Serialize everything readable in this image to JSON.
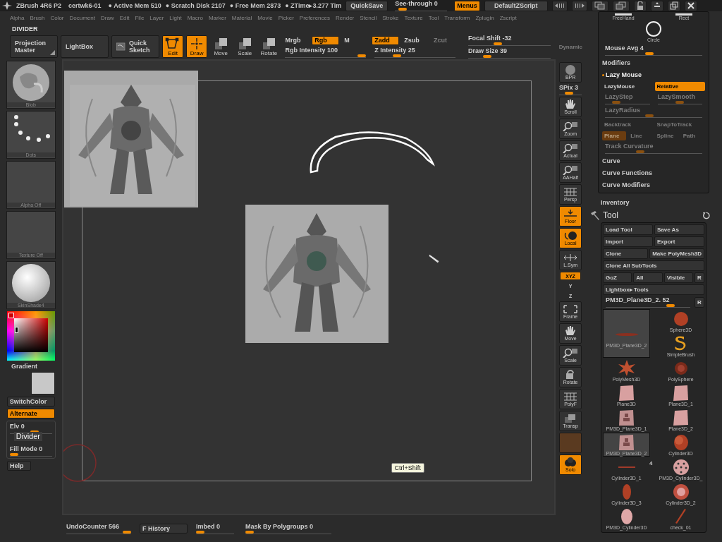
{
  "title_bar": {
    "app": "ZBrush 4R6 P2",
    "document": "certwk6-01",
    "stats": [
      "● Active Mem 510",
      "● Scratch Disk 2107",
      "● Free Mem 2873",
      "● ZTime▸3.277 Tim"
    ],
    "quicksave": "QuickSave",
    "see_through": {
      "label": "See-through  0",
      "level": 0.08
    },
    "menus": {
      "label": "Menus",
      "on": true
    },
    "zscript": "DefaultZScript"
  },
  "menu_bar": [
    "Alpha",
    "Brush",
    "Color",
    "Document",
    "Draw",
    "Edit",
    "File",
    "Layer",
    "Light",
    "Macro",
    "Marker",
    "Material",
    "Movie",
    "Picker",
    "Preferences",
    "Render",
    "Stencil",
    "Stroke",
    "Texture",
    "Tool",
    "Transform",
    "Zplugin",
    "Zscript"
  ],
  "palette_title": "DIVIDER",
  "toolbar": {
    "big_buttons": [
      {
        "label": "Projection Master",
        "kind": "corner"
      },
      {
        "label": "LightBox",
        "kind": "plain"
      },
      {
        "label": "Quick Sketch",
        "kind": "sketch"
      }
    ],
    "modes": [
      {
        "label": "Edit",
        "on": true,
        "kind": "edit"
      },
      {
        "label": "Draw",
        "on": true,
        "kind": "draw"
      },
      {
        "label": "Move",
        "on": false,
        "kind": "move"
      },
      {
        "label": "Scale",
        "on": false,
        "kind": "scale"
      },
      {
        "label": "Rotate",
        "on": false,
        "kind": "rotate"
      }
    ],
    "color_modes": [
      {
        "label": "Mrgb",
        "on": false
      },
      {
        "label": "Rgb",
        "on": true
      },
      {
        "label": "M",
        "on": false
      }
    ],
    "rgb_intensity": {
      "label": "Rgb  Intensity 100",
      "level": 1
    },
    "z_modes": [
      {
        "label": "Zadd",
        "on": true,
        "disabled": false
      },
      {
        "label": "Zsub",
        "on": false,
        "disabled": false
      },
      {
        "label": "Zcut",
        "on": false,
        "disabled": true
      }
    ],
    "z_intensity": {
      "label": "Z  Intensity 25",
      "level": 0.25
    },
    "focal_shift": {
      "label": "Focal  Shift -32",
      "level": 0.34
    },
    "draw_size": {
      "label": "Draw  Size 39",
      "level": 0.2
    },
    "dynamic": {
      "label": "Dynamic",
      "disabled": true
    }
  },
  "left_shelf": {
    "thumbs": [
      {
        "label": "Blob",
        "kind": "material"
      },
      {
        "label": "Dots",
        "kind": "dots"
      },
      {
        "label": "Alpha  Off",
        "kind": "empty"
      },
      {
        "label": "Texture  Off",
        "kind": "empty"
      },
      {
        "label": "SkinShade4",
        "kind": "sphere"
      }
    ],
    "gradient": "Gradient",
    "buttons": [
      {
        "label": "SwitchColor",
        "on": false
      },
      {
        "label": "Alternate",
        "on": true
      }
    ],
    "elv": {
      "label": "Elv 0",
      "level": 0.6
    },
    "fill_mode": {
      "label": "Fill Mode 0",
      "level": 0
    },
    "tooltip": "Divider",
    "help": "Help"
  },
  "canvas": {
    "tooltip": "Ctrl+Shift"
  },
  "right_toolbar": [
    {
      "label": "BPR",
      "kind": "bpr",
      "on": false
    },
    {
      "label": "SPix 3",
      "kind": "slider",
      "level": 0.4
    },
    {
      "label": "Scroll",
      "kind": "hand",
      "on": false
    },
    {
      "label": "Zoom",
      "kind": "zoom",
      "on": false
    },
    {
      "label": "Actual",
      "kind": "zoom",
      "on": false
    },
    {
      "label": "AAHalf",
      "kind": "zoom",
      "on": false
    },
    {
      "label": "Persp",
      "kind": "grid",
      "on": false
    },
    {
      "label": "Floor",
      "kind": "floor",
      "on": true
    },
    {
      "label": "Local",
      "kind": "local",
      "on": true
    },
    {
      "label": "L.Sym",
      "kind": "sym",
      "on": false
    },
    {
      "label": "XYZ",
      "kind": "axis",
      "on": true
    },
    {
      "label": "Y",
      "kind": "axis",
      "on": false
    },
    {
      "label": "Z",
      "kind": "axis",
      "on": false
    },
    {
      "label": "Frame",
      "kind": "frame",
      "on": false
    },
    {
      "label": "Move",
      "kind": "hand",
      "on": false
    },
    {
      "label": "Scale",
      "kind": "zoom",
      "on": false
    },
    {
      "label": "Rotate",
      "kind": "rotate",
      "on": false
    },
    {
      "label": "PolyF",
      "kind": "grid",
      "on": false
    },
    {
      "label": "Transp",
      "kind": "layers",
      "on": false
    },
    {
      "kind": "swatch",
      "on": false
    },
    {
      "label": "Solo",
      "kind": "solo",
      "on": true
    }
  ],
  "stroke_panel": {
    "types": [
      {
        "label": "FreeHand",
        "kind": "bar"
      },
      {
        "label": "Rect",
        "kind": "bar"
      },
      {
        "label": "Circle",
        "kind": "circle"
      }
    ],
    "mouse_avg": {
      "label": "Mouse  Avg 4",
      "level": 0.45
    },
    "modifiers": "Modifiers",
    "lazy_mouse": "Lazy Mouse",
    "rows": [
      [
        {
          "kind": "button",
          "label": "LazyMouse",
          "on": false,
          "disabled": false
        },
        {
          "kind": "button",
          "label": "Relative",
          "on": true,
          "disabled": false
        }
      ],
      [
        {
          "kind": "slider",
          "label": "LazyStep",
          "level": 0.2,
          "disabled": true
        },
        {
          "kind": "slider",
          "label": "LazySmooth",
          "level": 0.5,
          "disabled": true
        }
      ],
      [
        {
          "kind": "slider",
          "label": "LazyRadius",
          "level": 0.45,
          "disabled": true
        }
      ],
      [
        {
          "kind": "button",
          "label": "Backtrack",
          "on": false,
          "disabled": true
        },
        {
          "kind": "button",
          "label": "SnapToTrack",
          "on": false,
          "disabled": true
        }
      ],
      [
        {
          "kind": "button",
          "label": "Plane",
          "on": true,
          "disabled": true
        },
        {
          "kind": "button",
          "label": "Line",
          "on": false,
          "disabled": true
        },
        {
          "kind": "button",
          "label": "Spline",
          "on": false,
          "disabled": true
        },
        {
          "kind": "button",
          "label": "Path",
          "on": false,
          "disabled": true
        }
      ],
      [
        {
          "kind": "slider",
          "label": "Track  Curvature",
          "level": 0.35,
          "disabled": true
        }
      ]
    ],
    "subpalettes": [
      "Curve",
      "Curve Functions",
      "Curve Modifiers"
    ]
  },
  "inventory": "Inventory",
  "tool": {
    "title": "Tool",
    "button_rows": [
      [
        "Load  Tool",
        "Save  As"
      ],
      [
        "Import",
        "Export"
      ],
      [
        "Clone",
        "Make  PolyMesh3D"
      ],
      [
        "Clone  All  SubTools"
      ],
      [
        "GoZ",
        "All",
        "Visible",
        "R"
      ],
      [
        "Lightbox▸ Tools"
      ]
    ],
    "current": {
      "label": "PM3D_Plane3D_2. 52",
      "level": 0.8,
      "button": "R"
    },
    "items": [
      {
        "label": "Sphere3D",
        "kind": "sphere",
        "selected": false
      },
      {
        "label": "PM3D_Plane3D_2",
        "kind": "streak",
        "selected": true
      },
      {
        "label": "SimpleBrush",
        "kind": "brush",
        "selected": false
      },
      {
        "label": "PolyMesh3D",
        "kind": "star",
        "selected": false
      },
      {
        "label": "PolySphere",
        "kind": "polysphere",
        "selected": false
      },
      {
        "label": "Plane3D",
        "kind": "plane",
        "selected": false
      },
      {
        "label": "Plane3D_1",
        "kind": "plane",
        "selected": false
      },
      {
        "label": "PM3D_Plane3D_1",
        "kind": "figure",
        "selected": false
      },
      {
        "label": "Plane3D_2",
        "kind": "plane",
        "selected": false
      },
      {
        "label": "PM3D_Plane3D_2",
        "kind": "figure",
        "selected": true
      },
      {
        "label": "Cylinder3D",
        "kind": "cylinder",
        "selected": false
      },
      {
        "label": "Cylinder3D_1",
        "kind": "line",
        "selected": false
      },
      {
        "label": "PM3D_Cylinder3D_",
        "kind": "dotted",
        "selected": false
      },
      {
        "label": "Cylinder3D_3",
        "kind": "capsule",
        "selected": false
      },
      {
        "label": "Cylinder3D_2",
        "kind": "disc",
        "selected": false
      },
      {
        "label": "PM3D_Cylinder3D",
        "kind": "oval",
        "selected": false
      },
      {
        "label": "check_01",
        "kind": "stick",
        "selected": false
      }
    ],
    "badge": "4"
  },
  "bottom_bar": [
    {
      "label": "UndoCounter 566",
      "kind": "slider",
      "level": 1
    },
    {
      "label": "F History",
      "kind": "button"
    },
    {
      "label": "Imbed 0",
      "kind": "slider",
      "level": 0
    },
    {
      "label": "Mask By Polygroups 0",
      "kind": "slider",
      "level": 0
    }
  ]
}
